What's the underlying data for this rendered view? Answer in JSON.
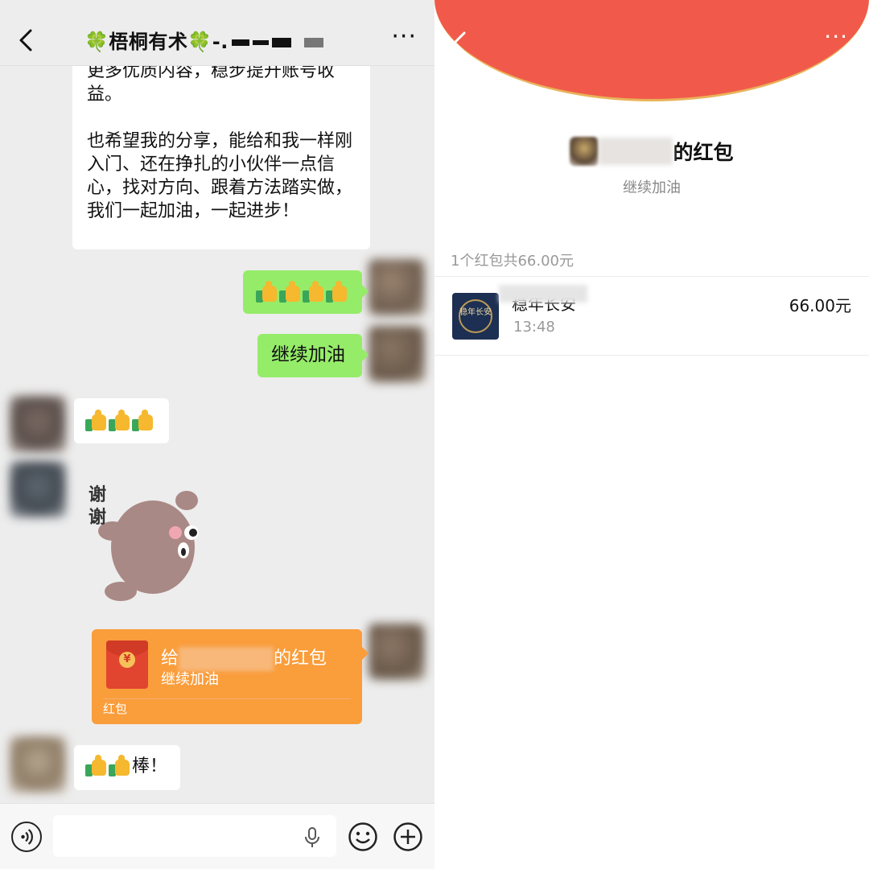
{
  "chat": {
    "title": "🍀梧桐有术🍀-.",
    "long_message": "更多优质内容，稳步提升账号收益。\n\n也希望我的分享，能给和我一样刚入门、还在挣扎的小伙伴一点信心，找对方向、跟着方法踏实做，我们一起加油，一起进步！",
    "msg_continue": "继续加油",
    "sticker_text": "谢谢",
    "msg_bang": "棒！",
    "red_packet": {
      "title_prefix": "给",
      "title_suffix": "的红包",
      "wish": "继续加油",
      "label": "红包",
      "coin_symbol": "¥"
    },
    "colors": {
      "background": "#ededed",
      "green_bubble": "#95ec69",
      "red_packet": "#fa9d3b"
    }
  },
  "detail": {
    "title_suffix": "的红包",
    "wish": "继续加油",
    "summary": "1个红包共66.00元",
    "item": {
      "name": "稳年长安",
      "time": "13:48",
      "amount": "66.00元",
      "avatar_text": "稳年长安"
    },
    "colors": {
      "header": "#f15a4a",
      "accent": "#e9b35a"
    }
  }
}
